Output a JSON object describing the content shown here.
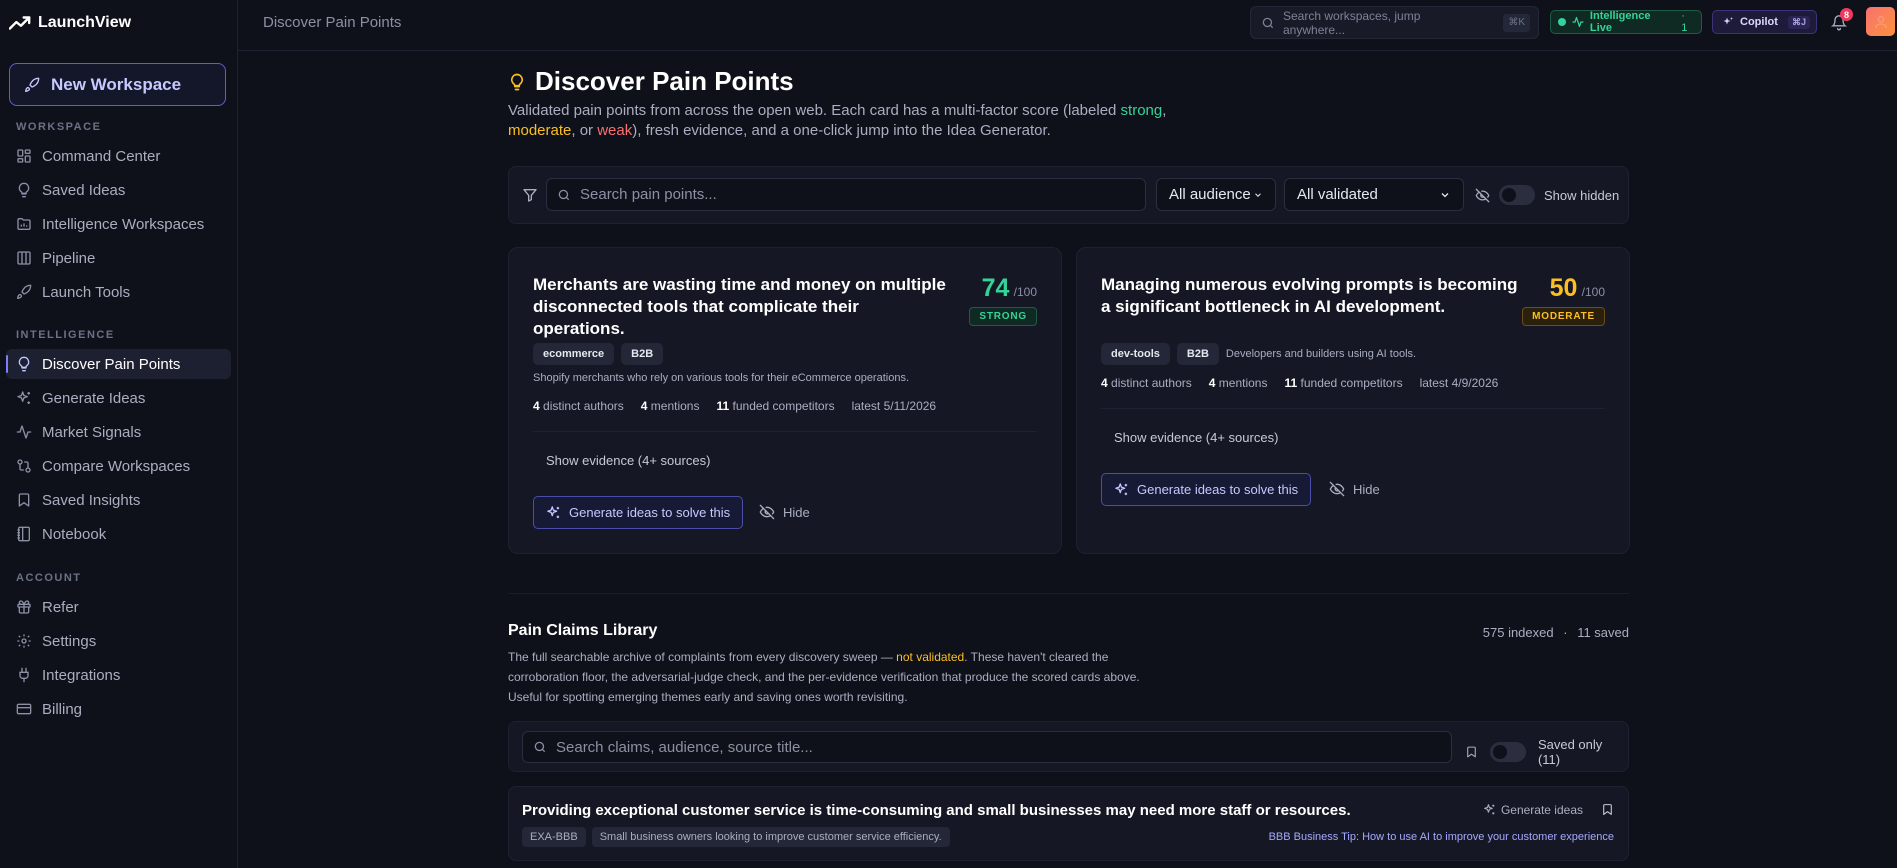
{
  "app": {
    "name": "LaunchView"
  },
  "sidebar": {
    "new_workspace": "New Workspace",
    "sections": {
      "workspace": "WORKSPACE",
      "intelligence": "INTELLIGENCE",
      "account": "ACCOUNT"
    },
    "items": [
      {
        "label": "Command Center",
        "icon": "grid-icon"
      },
      {
        "label": "Saved Ideas",
        "icon": "lightbulb-icon"
      },
      {
        "label": "Intelligence Workspaces",
        "icon": "folder-chart-icon"
      },
      {
        "label": "Pipeline",
        "icon": "columns-icon"
      },
      {
        "label": "Launch Tools",
        "icon": "rocket-icon"
      },
      {
        "label": "Discover Pain Points",
        "icon": "lightbulb-icon",
        "active": true
      },
      {
        "label": "Generate Ideas",
        "icon": "sparkles-icon"
      },
      {
        "label": "Market Signals",
        "icon": "activity-icon"
      },
      {
        "label": "Compare Workspaces",
        "icon": "git-compare-icon"
      },
      {
        "label": "Saved Insights",
        "icon": "bookmark-icon"
      },
      {
        "label": "Notebook",
        "icon": "notebook-icon"
      },
      {
        "label": "Refer",
        "icon": "gift-icon"
      },
      {
        "label": "Settings",
        "icon": "gear-icon"
      },
      {
        "label": "Integrations",
        "icon": "plug-icon"
      },
      {
        "label": "Billing",
        "icon": "card-icon"
      }
    ]
  },
  "topbar": {
    "breadcrumb": "Discover Pain Points",
    "search_placeholder": "Search workspaces, jump anywhere...",
    "search_shortcut": "⌘K",
    "intel_live": "Intelligence Live",
    "intel_count": "· 1",
    "copilot": "Copilot",
    "copilot_shortcut": "⌘J",
    "notifications": "8"
  },
  "page": {
    "title": "Discover Pain Points",
    "subtitle_parts": {
      "p1": "Validated pain points from across the open web. Each card has a multi-factor score (labeled ",
      "strong": "strong",
      "p2": ", ",
      "moderate": "moderate",
      "p3": ", or ",
      "weak": "weak",
      "p4": "), fresh evidence, and a one-click jump into the Idea Generator."
    }
  },
  "filters": {
    "search_placeholder": "Search pain points...",
    "audience": "All audience",
    "validated": "All validated",
    "show_hidden": "Show hidden"
  },
  "cards": [
    {
      "title": "Merchants are wasting time and money on multiple disconnected tools that complicate their operations.",
      "score": "74",
      "score_den": "/100",
      "label": "STRONG",
      "tags": [
        "ecommerce",
        "B2B"
      ],
      "audience": "Shopify merchants who rely on various tools for their eCommerce operations.",
      "authors": "4",
      "authors_label": "distinct authors",
      "mentions": "4",
      "mentions_label": "mentions",
      "competitors": "11",
      "competitors_label": "funded competitors",
      "latest": "latest 5/11/2026",
      "evidence": "Show evidence (4+ sources)",
      "generate": "Generate ideas to solve this",
      "hide": "Hide"
    },
    {
      "title": "Managing numerous evolving prompts is becoming a significant bottleneck in AI development.",
      "score": "50",
      "score_den": "/100",
      "label": "MODERATE",
      "tags": [
        "dev-tools",
        "B2B"
      ],
      "audience": "Developers and builders using AI tools.",
      "authors": "4",
      "authors_label": "distinct authors",
      "mentions": "4",
      "mentions_label": "mentions",
      "competitors": "11",
      "competitors_label": "funded competitors",
      "latest": "latest 4/9/2026",
      "evidence": "Show evidence (4+ sources)",
      "generate": "Generate ideas to solve this",
      "hide": "Hide"
    }
  ],
  "library": {
    "title": "Pain Claims Library",
    "indexed": "575 indexed",
    "sep": "·",
    "saved": "11 saved",
    "desc_p1": "The full searchable archive of complaints from every discovery sweep — ",
    "desc_notval": "not validated",
    "desc_p2": ". These haven't cleared the corroboration floor, the adversarial-judge check, and the per-evidence verification that produce the scored cards above. Useful for spotting emerging themes early and saving ones worth revisiting.",
    "search_placeholder": "Search claims, audience, source title...",
    "saved_only": "Saved only (11)",
    "claims": [
      {
        "title": "Providing exceptional customer service is time-consuming and small businesses may need more staff or resources.",
        "generate": "Generate ideas",
        "tag": "EXA-BBB",
        "audience": "Small business owners looking to improve customer service efficiency.",
        "source": "BBB Business Tip: How to use AI to improve your customer experience"
      }
    ]
  },
  "colors": {
    "accent": "#7c7ff5",
    "strong": "#34d399",
    "moderate": "#fbbf24",
    "weak": "#f87171"
  }
}
